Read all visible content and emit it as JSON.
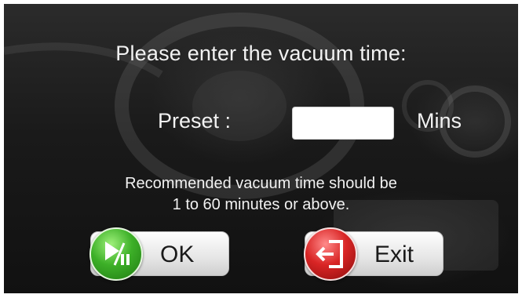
{
  "dialog": {
    "title": "Please enter the vacuum time:",
    "preset_label": "Preset :",
    "preset_value": "",
    "unit_label": "Mins",
    "hint_line1": "Recommended vacuum time should be",
    "hint_line2": "1 to 60 minutes or above."
  },
  "buttons": {
    "ok": {
      "label": "OK",
      "icon": "play-pause-icon",
      "color": "#3db028"
    },
    "exit": {
      "label": "Exit",
      "icon": "exit-door-icon",
      "color": "#d92525"
    }
  }
}
